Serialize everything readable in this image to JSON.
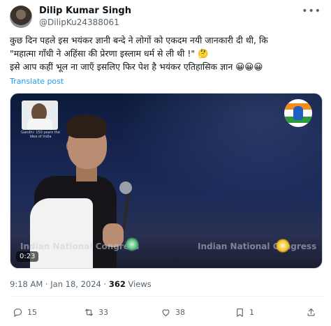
{
  "user": {
    "name": "Dilip Kumar Singh",
    "handle": "@DilipKu24388061"
  },
  "tweet": {
    "line1": "कुछ दिन पहले इस भयंकर ज्ञानी बन्दे ने लोगों को एकदम नयी जानकारी दी थी, कि",
    "line2": "\"महात्मा गाँधी ने अहिंसा की प्रेरणा इस्लाम धर्म से ली थी !\" 🤔",
    "line3": "इसे आप कहीं भूल ना जाएँ इसलिए फिर पेश है भयंकर एतिहासिक ज्ञान 😀😀😀",
    "translate": "Translate post"
  },
  "video": {
    "duration": "0:23",
    "watermark_left": "Indian National Congress",
    "watermark_right": "Indian National Congress",
    "inset_caption": "Gandhi: 150 years the Idea of India"
  },
  "meta": {
    "time": "9:18 AM",
    "sep": " · ",
    "date": "Jan 18, 2024",
    "sep2": " · ",
    "views_count": "362",
    "views_label": " Views"
  },
  "actions": {
    "replies": "15",
    "reposts": "33",
    "likes": "38",
    "bookmarks": "1"
  },
  "icons": [
    "more-icon",
    "reply-icon",
    "repost-icon",
    "like-icon",
    "bookmark-icon",
    "share-icon"
  ],
  "colors": {
    "link": "#1d9bf0",
    "muted": "#536471",
    "text": "#0f1419"
  }
}
